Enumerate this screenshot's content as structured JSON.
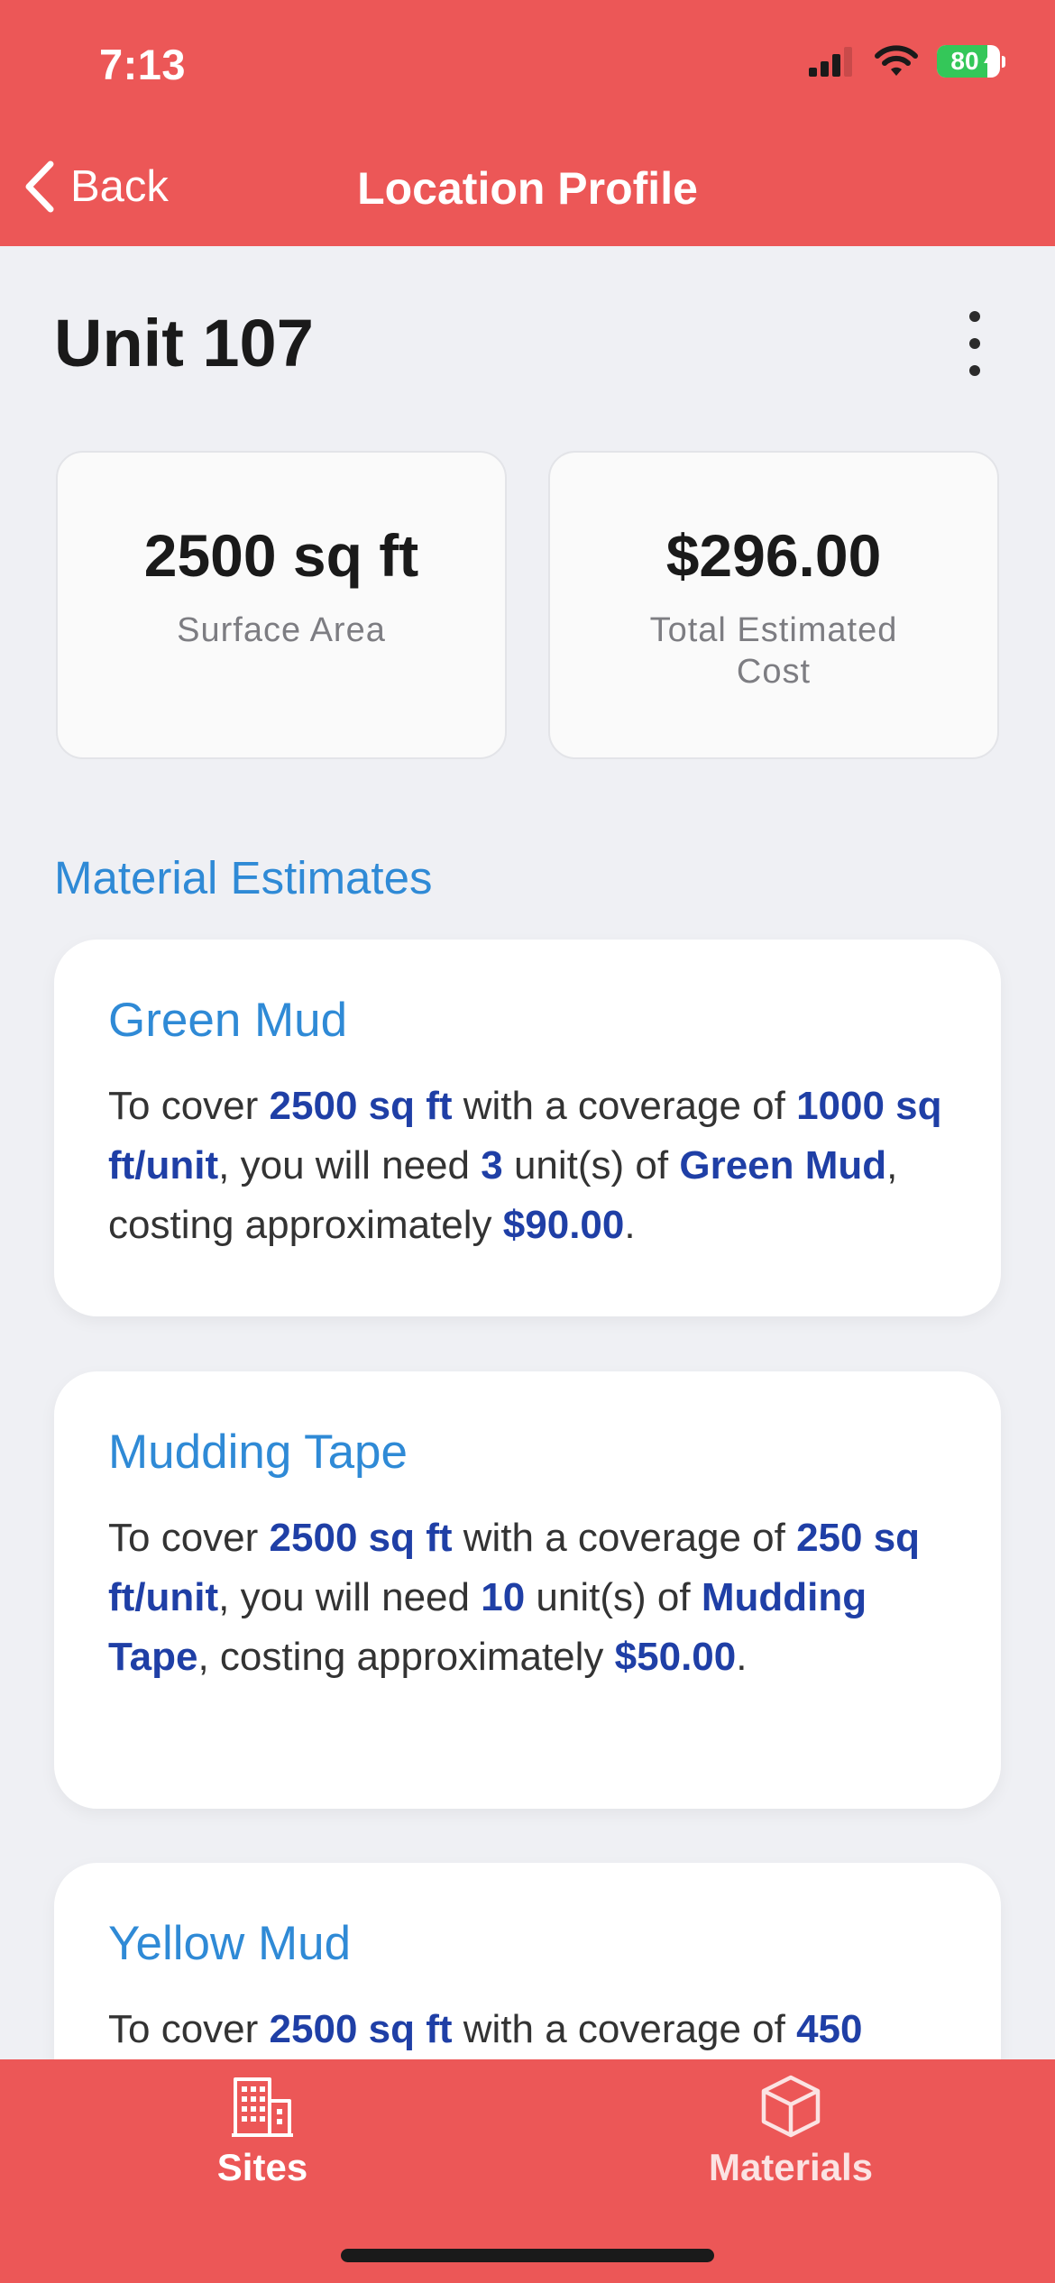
{
  "status_bar": {
    "time": "7:13",
    "battery": "80",
    "battery_level": 0.8
  },
  "nav": {
    "back_label": "Back",
    "title": "Location Profile"
  },
  "page": {
    "title": "Unit 107"
  },
  "stats": {
    "surface_area_value": "2500 sq ft",
    "surface_area_label": "Surface Area",
    "total_cost_value": "$296.00",
    "total_cost_label": "Total Estimated Cost"
  },
  "section": {
    "title": "Material Estimates"
  },
  "materials": [
    {
      "name": "Green Mud",
      "text_cover": "To cover",
      "area": "2500 sq ft",
      "text_coverage": "with a coverage of",
      "coverage": "1000 sq ft/unit",
      "text_need": ", you will need",
      "units": "3",
      "text_units_of": "unit(s) of",
      "material": "Green Mud",
      "text_costing": ", costing approximately",
      "cost": "$90.00",
      "text_end": "."
    },
    {
      "name": "Mudding Tape",
      "text_cover": "To cover",
      "area": "2500 sq ft",
      "text_coverage": "with a coverage of",
      "coverage": "250 sq ft/unit",
      "text_need": ", you will need",
      "units": "10",
      "text_units_of": "unit(s) of",
      "material": "Mudding Tape",
      "text_costing": ", costing approximately",
      "cost": "$50.00",
      "text_end": "."
    },
    {
      "name": "Yellow Mud",
      "text_cover": "To cover",
      "area": "2500 sq ft",
      "text_coverage": "with a coverage of",
      "coverage": "450"
    }
  ],
  "tabs": {
    "sites_label": "Sites",
    "materials_label": "Materials"
  },
  "colors": {
    "brand": "#ec5757",
    "accent_blue": "#2f8ad6",
    "emphasis_blue": "#1f3fa6",
    "background": "#eff0f4"
  }
}
